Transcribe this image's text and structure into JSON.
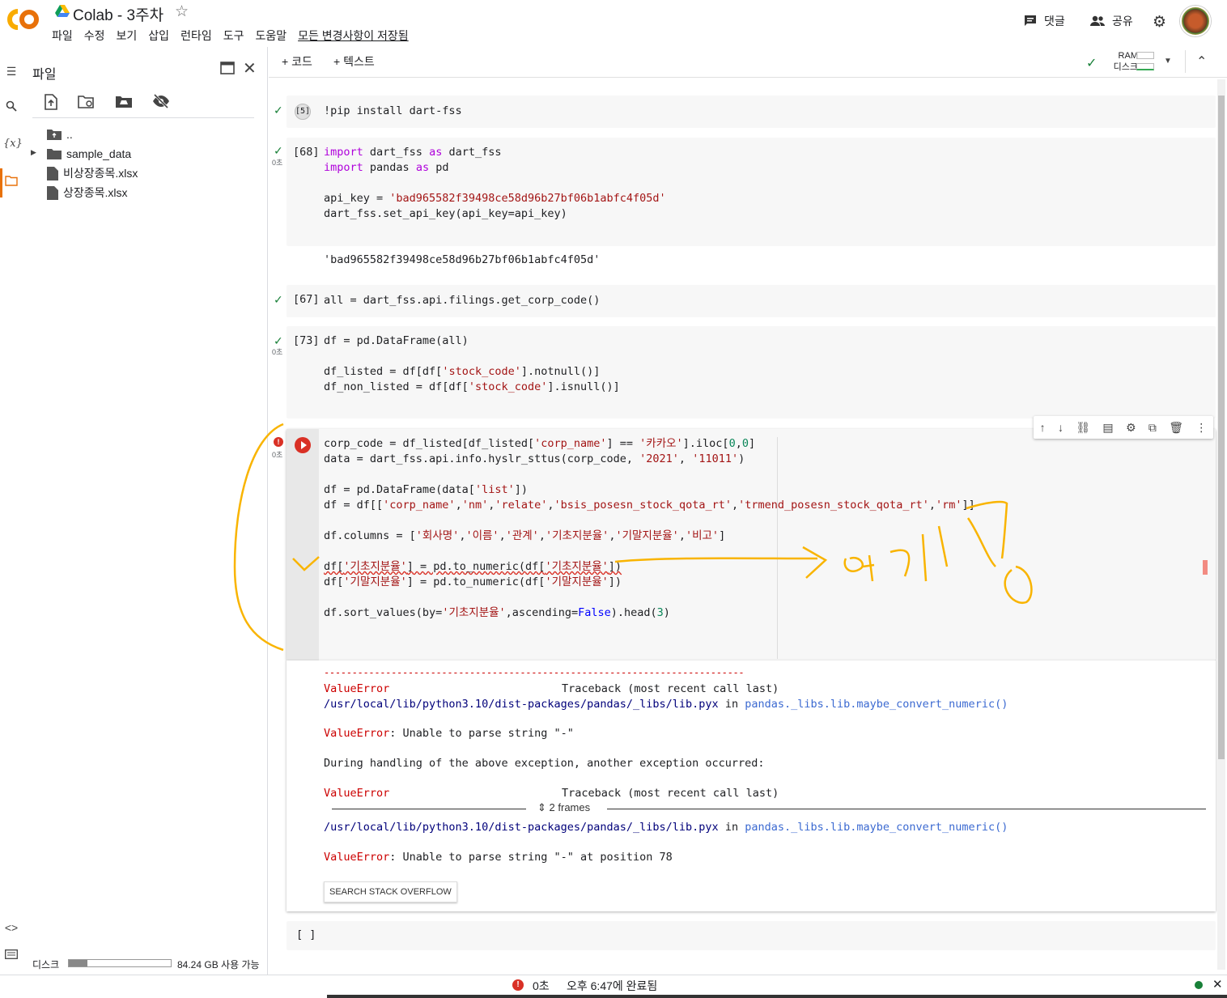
{
  "header": {
    "title": "Colab - 3주차",
    "menu": [
      "파일",
      "수정",
      "보기",
      "삽입",
      "런타임",
      "도구",
      "도움말"
    ],
    "saved_status": "모든 변경사항이 저장됨",
    "comment_label": "댓글",
    "share_label": "공유"
  },
  "sidebar": {
    "title": "파일",
    "tree": [
      {
        "name": ".."
      },
      {
        "name": "sample_data"
      },
      {
        "name": "비상장종목.xlsx"
      },
      {
        "name": "상장종목.xlsx"
      }
    ],
    "disk_label": "디스크",
    "disk_free": "84.24 GB 사용 가능",
    "disk_used_fraction": 0.18
  },
  "toolbar": {
    "add_code": "+ 코드",
    "add_text": "+ 텍스트",
    "ram_label": "RAM",
    "disk_label": "디스크"
  },
  "cells": {
    "c1": {
      "exec": "[5]",
      "code": "!pip install dart-fss"
    },
    "c2": {
      "exec": "[68]",
      "sec": "0초"
    },
    "c2_out": "'bad965582f39498ce58d96b27bf06b1abfc4f05d'",
    "c3": {
      "exec": "[67]",
      "code": "all = dart_fss.api.filings.get_corp_code()"
    },
    "c4": {
      "exec": "[73]",
      "sec": "0초"
    },
    "c5": {
      "sec": "0초"
    }
  },
  "error": {
    "dashes": "---------------------------------------------------------------------------",
    "type1": "ValueError",
    "traceback1": "Traceback (most recent call last)",
    "path1": "/usr/local/lib/python3.10/dist-packages/pandas/_libs/lib.pyx",
    "in_word": "in",
    "func1": "pandas._libs.lib.maybe_convert_numeric()",
    "msg1_type": "ValueError",
    "msg1": ": Unable to parse string \"-\"",
    "during": "During handling of the above exception, another exception occurred:",
    "type2": "ValueError",
    "traceback2": "Traceback (most recent call last)",
    "frames": "2 frames",
    "path2": "/usr/local/lib/python3.10/dist-packages/pandas/_libs/lib.pyx",
    "func2": "pandas._libs.lib.maybe_convert_numeric()",
    "msg2_type": "ValueError",
    "msg2": ": Unable to parse string \"-\" at position 78",
    "so_button": "SEARCH STACK OVERFLOW"
  },
  "empty_cell": "[ ]",
  "status": {
    "seconds": "0초",
    "completed": "오후 6:47에 완료됨"
  },
  "colors": {
    "accent_orange": "#f9ab00",
    "check_green": "#188038",
    "error_red": "#d93025"
  }
}
